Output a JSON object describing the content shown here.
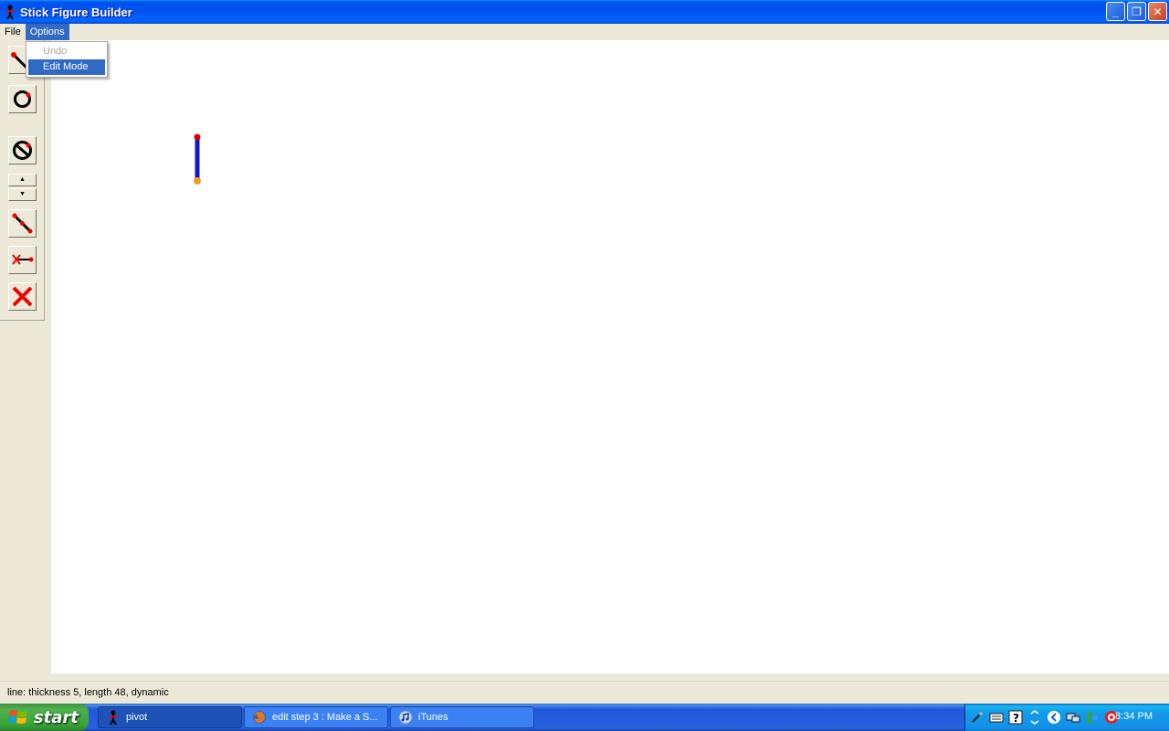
{
  "window": {
    "title": "Stick Figure Builder",
    "minimize_label": "_",
    "maximize_label": "❐",
    "close_label": "✕"
  },
  "menubar": {
    "file": "File",
    "options": "Options"
  },
  "options_menu": {
    "undo": "Undo",
    "edit_mode": "Edit Mode"
  },
  "toolbar": {
    "spin_up": "▲",
    "spin_down": "▼"
  },
  "status": {
    "text": "line: thickness 5, length 48, dynamic"
  },
  "taskbar": {
    "start_label": "start",
    "tasks": [
      {
        "label": "pivot"
      },
      {
        "label": "edit step 3 : Make a S..."
      },
      {
        "label": "iTunes"
      }
    ],
    "clock": "8:34 PM"
  },
  "colors": {
    "line": "#1414c8",
    "joint_red": "#e00000",
    "joint_orange": "#f0a020",
    "selection": "#316ac5"
  }
}
